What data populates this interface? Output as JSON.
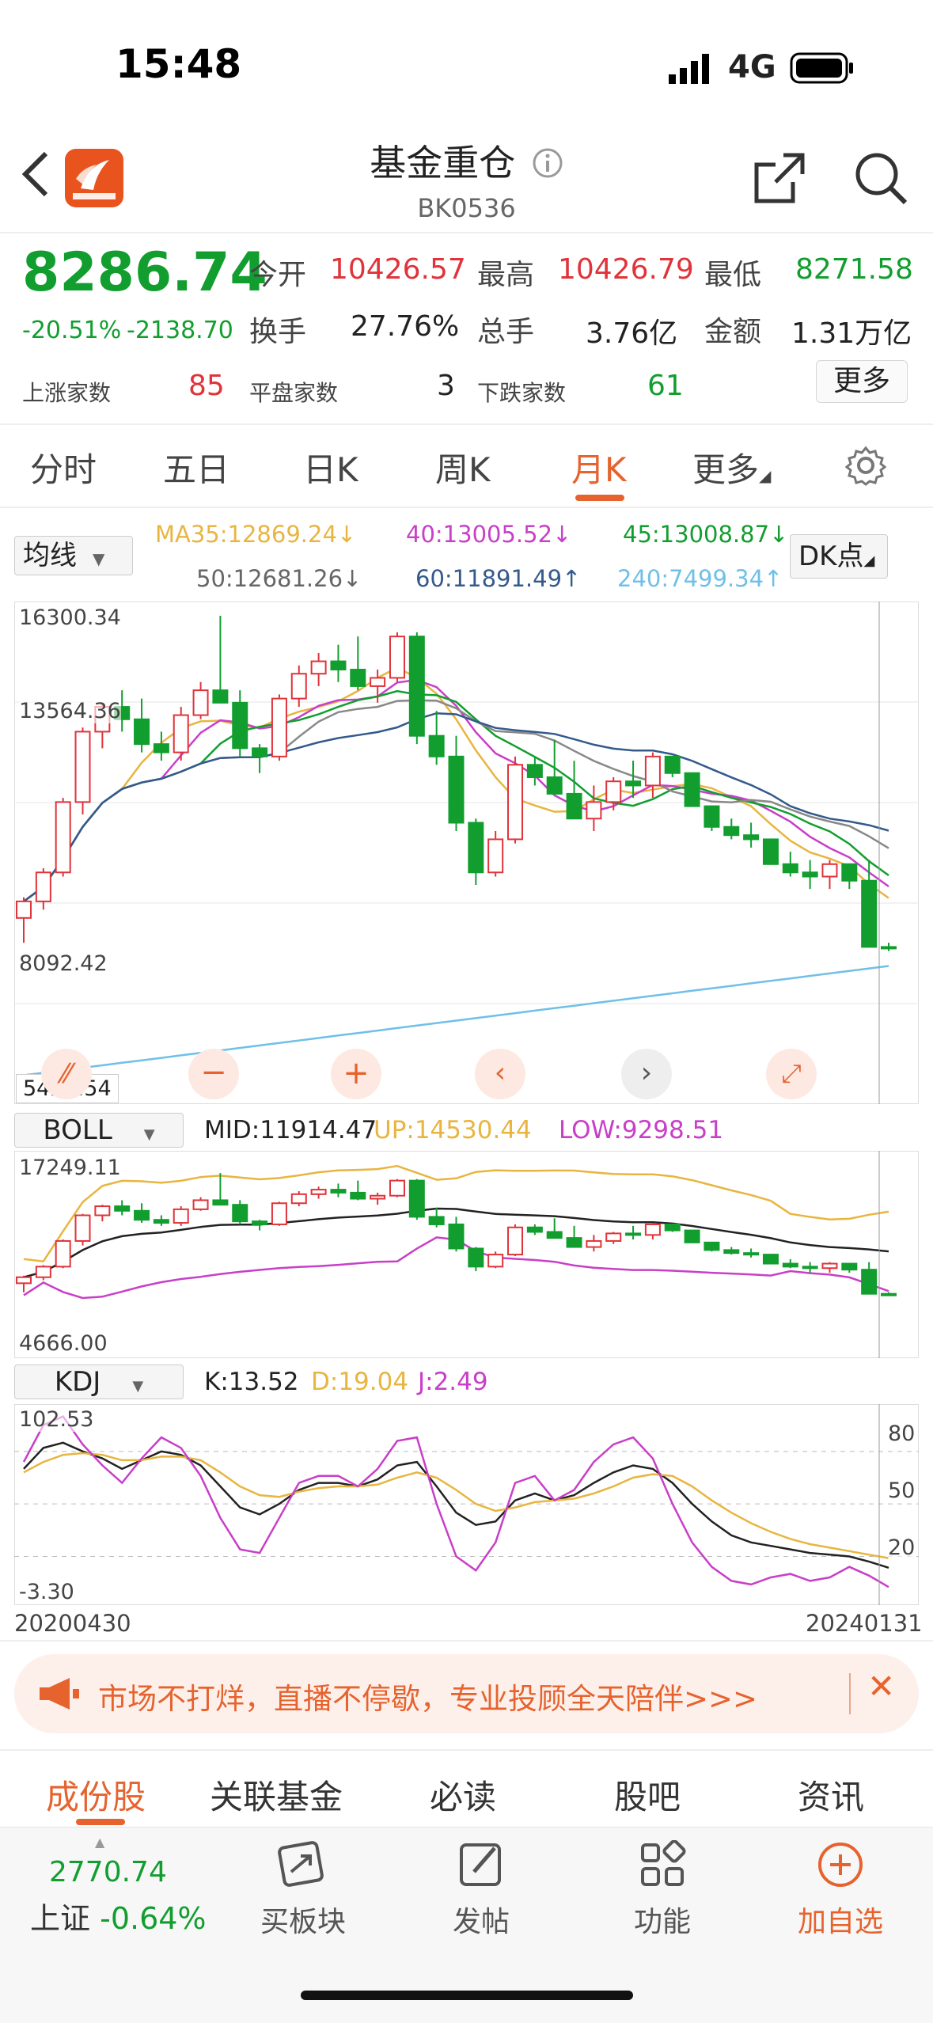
{
  "status": {
    "time": "15:48",
    "network": "4G"
  },
  "header": {
    "title": "基金重仓",
    "code": "BK0536"
  },
  "quote": {
    "price": "8286.74",
    "change_pct": "-20.51%",
    "change_abs": "-2138.70",
    "open_label": "今开",
    "open": "10426.57",
    "high_label": "最高",
    "high": "10426.79",
    "low_label": "最低",
    "low": "8271.58",
    "turnover_label": "换手",
    "turnover": "27.76%",
    "volume_label": "总手",
    "volume": "3.76亿",
    "amount_label": "金额",
    "amount": "1.31万亿",
    "up_label": "上涨家数",
    "up": "85",
    "flat_label": "平盘家数",
    "flat": "3",
    "down_label": "下跌家数",
    "down": "61",
    "more": "更多"
  },
  "ktabs": [
    "分时",
    "五日",
    "日K",
    "周K",
    "月K",
    "更多"
  ],
  "active_tab": "月K",
  "ma": {
    "selector": "均线",
    "ma35": "MA35:12869.24↓",
    "ma40": "40:13005.52↓",
    "ma45": "45:13008.87↓",
    "ma50": "50:12681.26↓",
    "ma60": "60:11891.49↑",
    "ma240": "240:7499.34↑",
    "dk": "DK点"
  },
  "kline_axis": {
    "top": "16300.34",
    "mid": "13564.36",
    "low": "8092.42",
    "bottom": "5420.54"
  },
  "boll": {
    "selector": "BOLL",
    "mid": "MID:11914.47",
    "up": "UP:14530.44",
    "low": "LOW:9298.51",
    "top": "17249.11",
    "bottom": "4666.00"
  },
  "kdj": {
    "selector": "KDJ",
    "k": "K:13.52",
    "d": "D:19.04",
    "j": "J:2.49",
    "top": "102.53",
    "bottom": "-3.30",
    "levels": [
      "80",
      "50",
      "20"
    ]
  },
  "dates": {
    "start": "20200430",
    "end": "20240131"
  },
  "banner": {
    "text": "市场不打烊，直播不停歇，专业投顾全天陪伴>>>"
  },
  "bottom_tabs": [
    "成份股",
    "关联基金",
    "必读",
    "股吧",
    "资讯"
  ],
  "footer": {
    "index_value": "2770.74",
    "index_name": "上证",
    "index_change": "-0.64%",
    "items": [
      "买板块",
      "发帖",
      "功能",
      "加自选"
    ]
  },
  "colors": {
    "up": "#e0333a",
    "down": "#129e2f",
    "accent": "#e6632e"
  },
  "chart_data": [
    {
      "type": "candlestick",
      "title": "月K",
      "x_start": "20200430",
      "x_end": "20240131",
      "ylim": [
        5420.54,
        16300.34
      ],
      "ohlc": [
        [
          9000,
          9500,
          8400,
          9400
        ],
        [
          9400,
          10200,
          9200,
          10100
        ],
        [
          10100,
          11900,
          10000,
          11800
        ],
        [
          11800,
          13600,
          11500,
          13500
        ],
        [
          13500,
          14200,
          13100,
          14100
        ],
        [
          14100,
          14500,
          13500,
          13800
        ],
        [
          13800,
          14300,
          13000,
          13200
        ],
        [
          13200,
          13500,
          12800,
          13000
        ],
        [
          13000,
          14100,
          12800,
          13900
        ],
        [
          13900,
          14700,
          13800,
          14500
        ],
        [
          14500,
          16300,
          14200,
          14200
        ],
        [
          14200,
          14500,
          12900,
          13100
        ],
        [
          13100,
          13200,
          12500,
          12900
        ],
        [
          12900,
          14400,
          12800,
          14300
        ],
        [
          14300,
          15100,
          14100,
          14900
        ],
        [
          14900,
          15400,
          14600,
          15200
        ],
        [
          15200,
          15600,
          14700,
          15000
        ],
        [
          15000,
          15800,
          14500,
          14600
        ],
        [
          14600,
          15000,
          14200,
          14800
        ],
        [
          14800,
          15900,
          14700,
          15800
        ],
        [
          15800,
          15900,
          13200,
          13400
        ],
        [
          13400,
          14000,
          12700,
          12900
        ],
        [
          12900,
          13400,
          11100,
          11300
        ],
        [
          11300,
          11400,
          9800,
          10100
        ],
        [
          10100,
          11100,
          10000,
          10900
        ],
        [
          10900,
          12900,
          10800,
          12700
        ],
        [
          12700,
          12900,
          12200,
          12400
        ],
        [
          12400,
          13300,
          12100,
          12000
        ],
        [
          12000,
          12800,
          11400,
          11400
        ],
        [
          11400,
          12200,
          11100,
          11800
        ],
        [
          11800,
          12400,
          11600,
          12300
        ],
        [
          12300,
          12800,
          11900,
          12200
        ],
        [
          12200,
          13000,
          11900,
          12900
        ],
        [
          12900,
          12800,
          12400,
          12500
        ],
        [
          12500,
          12500,
          11800,
          11700
        ],
        [
          11700,
          11700,
          11100,
          11200
        ],
        [
          11200,
          11400,
          10900,
          11000
        ],
        [
          11000,
          11300,
          10700,
          10900
        ],
        [
          10900,
          10900,
          10300,
          10300
        ],
        [
          10300,
          10600,
          10000,
          10100
        ],
        [
          10100,
          10400,
          9700,
          10000
        ],
        [
          10000,
          10400,
          9700,
          10300
        ],
        [
          10300,
          10300,
          9700,
          9900
        ],
        [
          9900,
          10400,
          8300,
          8300
        ],
        [
          8300,
          8400,
          8200,
          8286.74
        ]
      ]
    },
    {
      "type": "line",
      "title": "KDJ",
      "ylim": [
        -3.3,
        102.53
      ],
      "series": [
        {
          "name": "K",
          "values": [
            70,
            82,
            85,
            80,
            76,
            70,
            75,
            80,
            78,
            72,
            60,
            48,
            44,
            50,
            58,
            62,
            62,
            60,
            64,
            72,
            74,
            60,
            45,
            38,
            40,
            52,
            56,
            52,
            55,
            62,
            68,
            72,
            70,
            62,
            50,
            40,
            32,
            28,
            26,
            24,
            22,
            21,
            20,
            17,
            13.52
          ]
        },
        {
          "name": "D",
          "values": [
            68,
            74,
            78,
            79,
            78,
            75,
            75,
            77,
            77,
            75,
            68,
            60,
            55,
            54,
            57,
            59,
            60,
            60,
            61,
            65,
            68,
            65,
            58,
            50,
            46,
            48,
            51,
            52,
            53,
            56,
            60,
            65,
            67,
            66,
            60,
            52,
            45,
            39,
            34,
            30,
            27,
            25,
            23,
            21,
            19.04
          ]
        },
        {
          "name": "J",
          "values": [
            74,
            95,
            100,
            84,
            72,
            62,
            76,
            88,
            82,
            66,
            42,
            24,
            22,
            42,
            62,
            66,
            66,
            60,
            70,
            86,
            88,
            50,
            20,
            12,
            28,
            62,
            66,
            52,
            58,
            74,
            84,
            88,
            76,
            50,
            28,
            14,
            6,
            4,
            8,
            10,
            6,
            8,
            14,
            9,
            2.49
          ]
        }
      ]
    }
  ]
}
